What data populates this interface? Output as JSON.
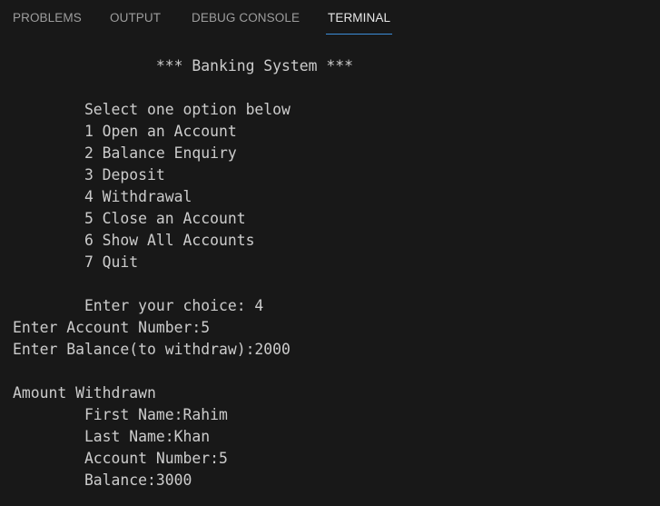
{
  "panel": {
    "tabs": [
      {
        "label": "PROBLEMS",
        "active": false
      },
      {
        "label": "OUTPUT",
        "active": false
      },
      {
        "label": "DEBUG CONSOLE",
        "active": false
      },
      {
        "label": "TERMINAL",
        "active": true
      }
    ]
  },
  "terminal": {
    "lines": [
      "                *** Banking System ***",
      "",
      "        Select one option below",
      "        1 Open an Account",
      "        2 Balance Enquiry",
      "        3 Deposit",
      "        4 Withdrawal",
      "        5 Close an Account",
      "        6 Show All Accounts",
      "        7 Quit",
      "",
      "        Enter your choice: 4",
      "Enter Account Number:5",
      "Enter Balance(to withdraw):2000",
      "",
      "Amount Withdrawn",
      "        First Name:Rahim",
      "        Last Name:Khan",
      "        Account Number:5",
      "        Balance:3000"
    ]
  },
  "colors": {
    "background": "#181818",
    "text": "#cccccc",
    "tab_inactive": "#9d9d9d",
    "tab_active": "#e7e7e7",
    "tab_active_underline": "#3c8cd8"
  }
}
